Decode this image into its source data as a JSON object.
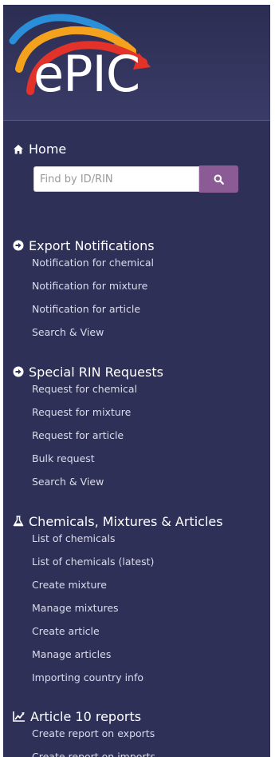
{
  "brand": {
    "logo_text": "ePIC"
  },
  "home": {
    "label": "Home"
  },
  "search": {
    "placeholder": "Find by ID/RIN"
  },
  "sections": [
    {
      "title": "Export Notifications",
      "icon": "circle-arrow-right-icon",
      "items": [
        "Notification for chemical",
        "Notification for mixture",
        "Notification for article",
        "Search & View"
      ]
    },
    {
      "title": "Special RIN Requests",
      "icon": "circle-arrow-right-icon",
      "items": [
        "Request for chemical",
        "Request for mixture",
        "Request for article",
        "Bulk request",
        "Search & View"
      ]
    },
    {
      "title": "Chemicals, Mixtures & Articles",
      "icon": "flask-icon",
      "items": [
        "List of chemicals",
        "List of chemicals (latest)",
        "Create mixture",
        "Manage mixtures",
        "Create article",
        "Manage articles",
        "Importing country info"
      ]
    },
    {
      "title": "Article 10 reports",
      "icon": "line-chart-icon",
      "items": [
        "Create report on exports",
        "Create report on imports"
      ]
    }
  ],
  "colors": {
    "sidebar_bg": "#2e3057",
    "search_button": "#8b5b95",
    "item_text": "#dcdcec"
  }
}
